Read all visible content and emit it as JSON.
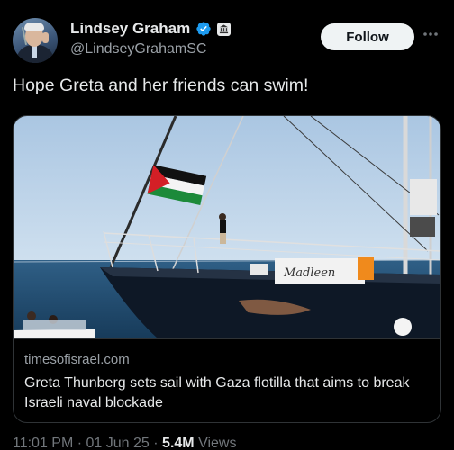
{
  "author": {
    "name": "Lindsey Graham",
    "handle": "@LindseyGrahamSC",
    "verified_icon": "verified-badge-icon",
    "affiliation_icon": "government-building-icon"
  },
  "actions": {
    "follow_label": "Follow",
    "menu_icon": "more-icon"
  },
  "tweet": {
    "text": "Hope Greta and her friends can swim!"
  },
  "card": {
    "domain": "timesofisrael.com",
    "headline": "Greta Thunberg sets sail with Gaza flotilla that aims to break Israeli naval blockade",
    "image_boat_name": "Madleen"
  },
  "meta": {
    "time": "11:01 PM",
    "date": "01 Jun 25",
    "separator": "·",
    "views_count": "5.4M",
    "views_label": "Views"
  },
  "colors": {
    "background": "#000000",
    "text": "#e7e9ea",
    "muted": "#71767b",
    "verified": "#1d9bf0"
  }
}
